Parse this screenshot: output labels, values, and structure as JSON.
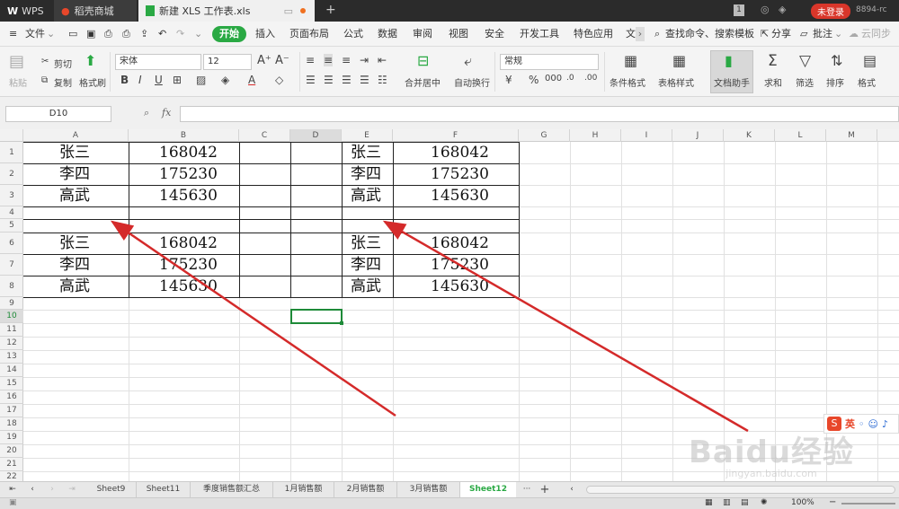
{
  "titlebar": {
    "tabs": [
      "WPS",
      "稻壳商城",
      "新建 XLS 工作表.xls"
    ],
    "page_num": "1",
    "login": "未登录",
    "user": "8894-rc"
  },
  "menu": {
    "file": "文件",
    "items": [
      "开始",
      "插入",
      "页面布局",
      "公式",
      "数据",
      "审阅",
      "视图",
      "安全",
      "开发工具",
      "特色应用",
      "文"
    ],
    "search": "查找命令、搜索模板",
    "share": "分享",
    "comment": "批注",
    "cloud": "云同步"
  },
  "ribbon": {
    "paste": "粘贴",
    "cut": "剪切",
    "copy": "复制",
    "format_painter": "格式刷",
    "font_name": "宋体",
    "font_size": "12",
    "merge_center": "合并居中",
    "wrap": "自动换行",
    "number_format": "常规",
    "cond_format": "条件格式",
    "table_style": "表格样式",
    "doc_helper": "文档助手",
    "sum": "求和",
    "filter": "筛选",
    "sort": "排序",
    "format": "格式"
  },
  "formula": {
    "name_box": "D10",
    "fx": "fx",
    "value": ""
  },
  "grid": {
    "columns": [
      "A",
      "B",
      "C",
      "D",
      "E",
      "F",
      "G",
      "H",
      "I",
      "J",
      "K",
      "L",
      "M"
    ],
    "rows": [
      "1",
      "2",
      "3",
      "4",
      "5",
      "6",
      "7",
      "8",
      "9",
      "10",
      "11",
      "12",
      "13",
      "14",
      "15",
      "16",
      "17",
      "18",
      "19",
      "20",
      "21",
      "22"
    ],
    "table1": [
      [
        "张三",
        "168042"
      ],
      [
        "李四",
        "175230"
      ],
      [
        "高武",
        "145630"
      ]
    ],
    "table2": [
      [
        "张三",
        "168042"
      ],
      [
        "李四",
        "175230"
      ],
      [
        "高武",
        "145630"
      ]
    ],
    "table3": [
      [
        "张三",
        "168042"
      ],
      [
        "李四",
        "175230"
      ],
      [
        "高武",
        "145630"
      ]
    ],
    "table4": [
      [
        "张三",
        "168042"
      ],
      [
        "李四",
        "175230"
      ],
      [
        "高武",
        "145630"
      ]
    ],
    "selected_cell": "D10"
  },
  "sheets": {
    "tabs": [
      "Sheet9",
      "Sheet11",
      "季度销售额汇总",
      "1月销售额",
      "2月销售额",
      "3月销售额",
      "Sheet12"
    ],
    "active": "Sheet12",
    "more": "···",
    "add": "+"
  },
  "status": {
    "zoom": "100%"
  },
  "ime": {
    "label": "英"
  },
  "watermark": {
    "text": "Baidu经验",
    "url": "jingyan.baidu.com"
  },
  "colors": {
    "accent": "#2aa944",
    "login": "#d9362a",
    "arrow": "#d42a2a",
    "selection": "#1e8a38"
  }
}
